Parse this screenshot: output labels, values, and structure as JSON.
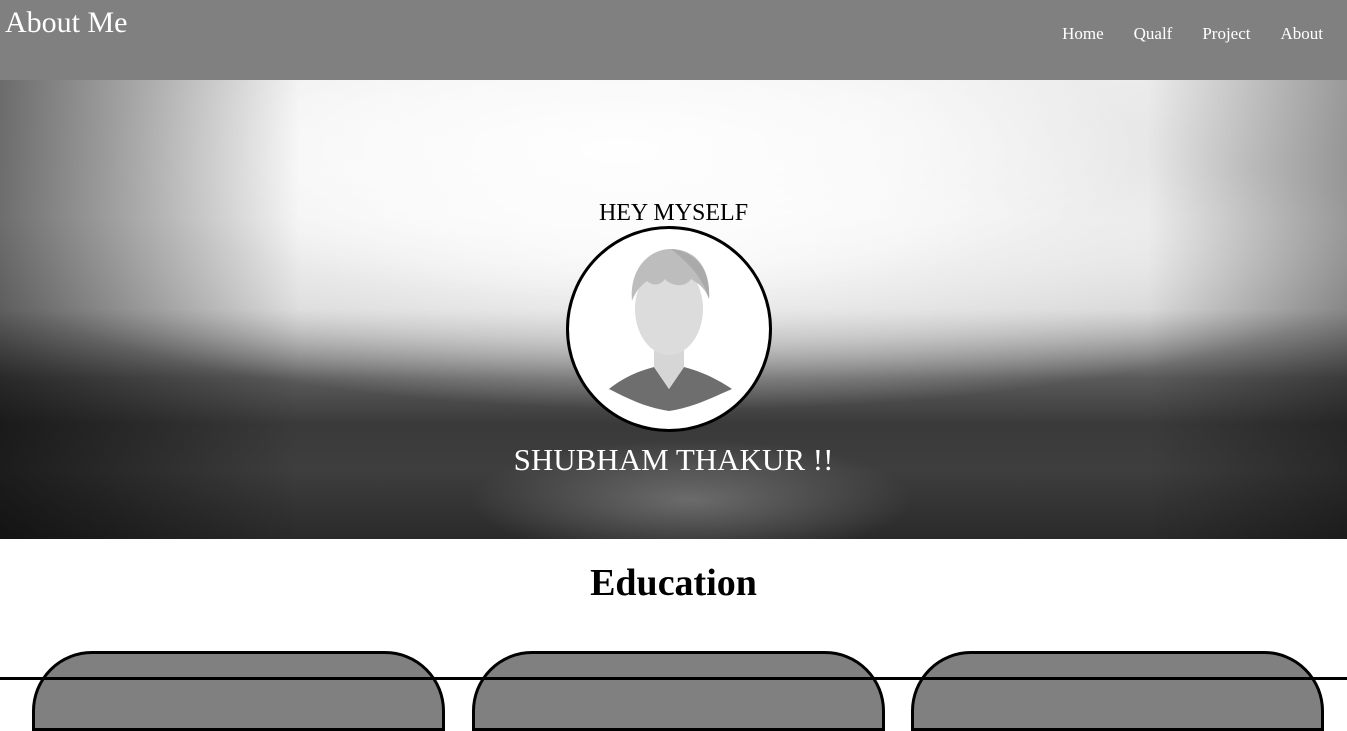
{
  "header": {
    "title": "About Me",
    "nav": [
      "Home",
      "Qualf",
      "Project",
      "About"
    ]
  },
  "hero": {
    "greeting": "HEY MYSELF",
    "name": "SHUBHAM THAKUR !!",
    "avatar_icon": "user-avatar-icon"
  },
  "education": {
    "title": "Education",
    "cards": [
      "",
      "",
      ""
    ]
  },
  "colors": {
    "header_bg": "#808080",
    "card_bg": "#808080",
    "text_light": "#ffffff",
    "text_dark": "#000000"
  }
}
